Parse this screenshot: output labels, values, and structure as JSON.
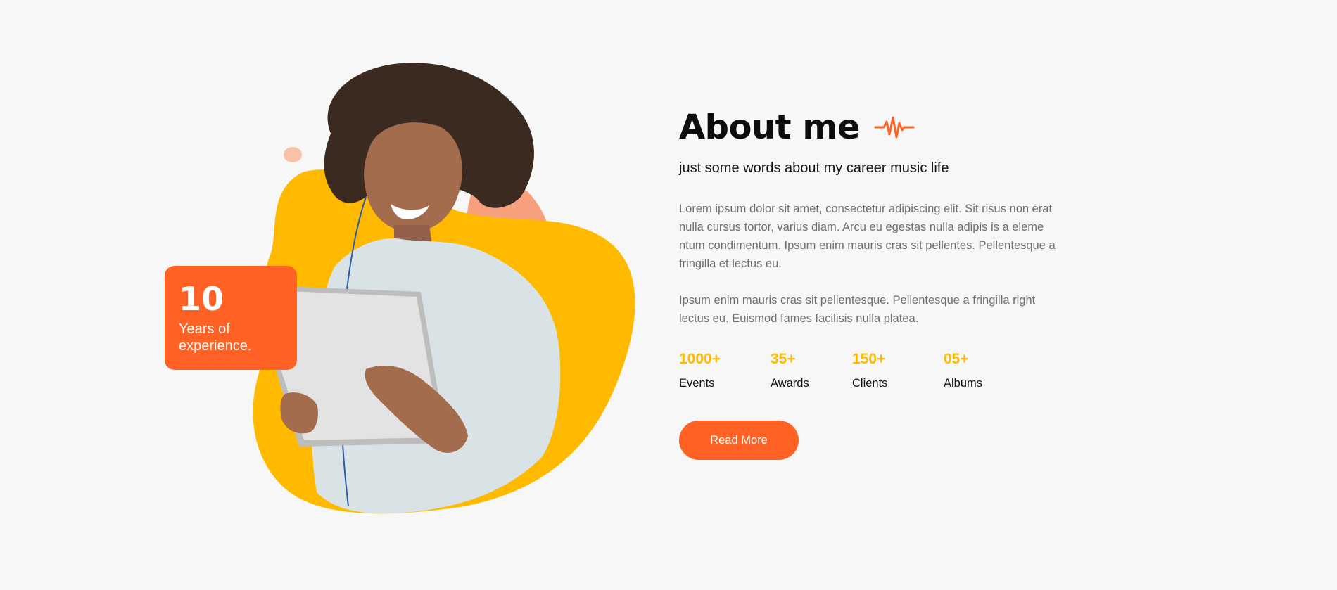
{
  "colors": {
    "background": "#f7f7f7",
    "accent_orange": "#ff6224",
    "accent_yellow": "#ffba00",
    "blob_peach": "#f7a07e",
    "text_dark": "#0d0d0d",
    "text_body": "#6f6f6f"
  },
  "experience": {
    "number": "10",
    "text": "Years of experience."
  },
  "about": {
    "title": "About me",
    "title_icon": "pulse-wave-icon",
    "subtitle": "just some words about my career music life",
    "paragraph_1": "Lorem ipsum dolor sit amet, consectetur adipiscing elit. Sit risus non erat nulla cursus tortor, varius diam. Arcu eu egestas nulla adipis is a eleme ntum condimentum. Ipsum enim mauris cras sit pellentes. Pellentesque a fringilla et lectus eu.",
    "paragraph_2": "Ipsum enim mauris cras sit pellentesque. Pellentesque a fringilla  right lectus eu. Euismod fames facilisis nulla platea."
  },
  "stats": [
    {
      "value": "1000+",
      "label": "Events"
    },
    {
      "value": "35+",
      "label": "Awards"
    },
    {
      "value": "150+",
      "label": "Clients"
    },
    {
      "value": "05+",
      "label": "Albums"
    }
  ],
  "cta": {
    "label": "Read More"
  }
}
